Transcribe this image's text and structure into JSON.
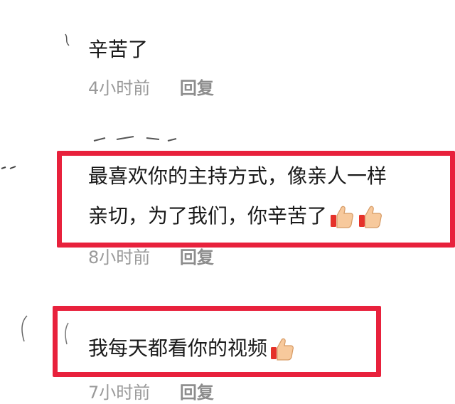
{
  "comments": [
    {
      "text": "辛苦了",
      "time": "4小时前",
      "reply_label": "回复"
    },
    {
      "text_line1": "最喜欢你的主持方式，像亲人一样",
      "text_line2": "亲切，为了我们，你辛苦了",
      "emoji": "thumbs-up",
      "emoji_count": 2,
      "time": "8小时前",
      "reply_label": "回复"
    },
    {
      "text": "我每天都看你的视频",
      "emoji": "thumbs-up",
      "emoji_count": 1,
      "time": "7小时前",
      "reply_label": "回复"
    }
  ],
  "colors": {
    "highlight": "#e8213c",
    "meta_text": "#9a9a9a",
    "comment_text": "#1a1a1a"
  }
}
